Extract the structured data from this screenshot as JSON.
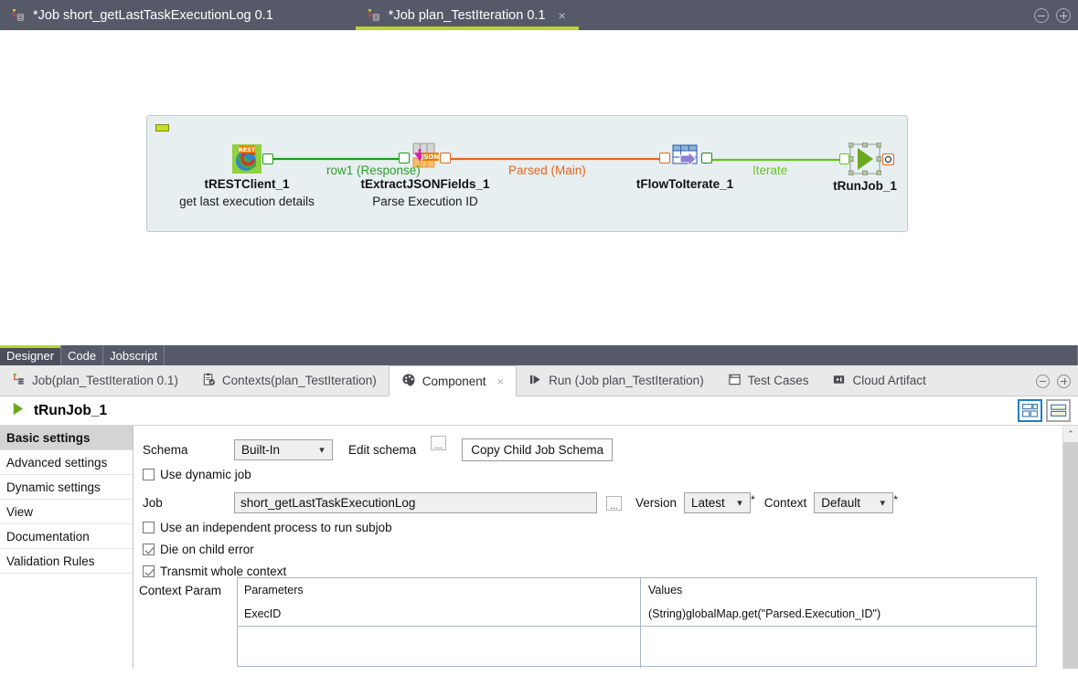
{
  "editor_tabs": [
    {
      "label": "*Job short_getLastTaskExecutionLog 0.1",
      "icon": "job-icon",
      "active": false,
      "closable": false
    },
    {
      "label": "*Job plan_TestIteration 0.1",
      "icon": "job-icon",
      "active": true,
      "closable": true,
      "close_label": "×"
    }
  ],
  "window_controls": {
    "minimize": "minimize-icon",
    "maximize": "maximize-icon"
  },
  "canvas": {
    "subjob_marker": "subjob-collapse-marker",
    "nodes": [
      {
        "name": "tRESTClient_1",
        "label": "tRESTClient_1",
        "sublabel": "get last execution details",
        "icon": "rest-client-icon"
      },
      {
        "name": "tExtractJSONFields_1",
        "label": "tExtractJSONFields_1",
        "sublabel": "Parse Execution ID",
        "icon": "extract-json-fields-icon"
      },
      {
        "name": "tFlowToIterate_1",
        "label": "tFlowToIterate_1",
        "sublabel": "",
        "icon": "flow-to-iterate-icon"
      },
      {
        "name": "tRunJob_1",
        "label": "tRunJob_1",
        "sublabel": "",
        "icon": "run-job-icon"
      }
    ],
    "links": [
      {
        "label": "row1 (Response)",
        "color": "#2aa02a"
      },
      {
        "label": "Parsed (Main)",
        "color": "#e8641c"
      },
      {
        "label": "Iterate",
        "color": "#66c41f"
      }
    ]
  },
  "designer_tabs": [
    {
      "label": "Designer",
      "active": true
    },
    {
      "label": "Code",
      "active": false
    },
    {
      "label": "Jobscript",
      "active": false
    }
  ],
  "view_tabs": [
    {
      "label": "Job(plan_TestIteration 0.1)",
      "icon": "job-icon",
      "active": false,
      "closable": false
    },
    {
      "label": "Contexts(plan_TestIteration)",
      "icon": "contexts-icon",
      "active": false,
      "closable": false
    },
    {
      "label": "Component",
      "icon": "component-palette-icon",
      "active": true,
      "closable": true,
      "close_label": "×"
    },
    {
      "label": "Run (Job plan_TestIteration)",
      "icon": "run-icon",
      "active": false,
      "closable": false
    },
    {
      "label": "Test Cases",
      "icon": "test-cases-icon",
      "active": false,
      "closable": false
    },
    {
      "label": "Cloud Artifact",
      "icon": "cloud-artifact-icon",
      "active": false,
      "closable": false
    }
  ],
  "component": {
    "title": "tRunJob_1",
    "icon": "run-job-icon",
    "view_toggle_grid": "grid-view-icon",
    "view_toggle_list": "list-view-icon"
  },
  "nav": {
    "items": [
      {
        "label": "Basic settings",
        "active": true
      },
      {
        "label": "Advanced settings",
        "active": false
      },
      {
        "label": "Dynamic settings",
        "active": false
      },
      {
        "label": "View",
        "active": false
      },
      {
        "label": "Documentation",
        "active": false
      },
      {
        "label": "Validation Rules",
        "active": false
      }
    ]
  },
  "basic_settings": {
    "schema_label": "Schema",
    "schema_value": "Built-In",
    "edit_schema_label": "Edit schema",
    "edit_schema_dots": "...",
    "copy_child_schema_label": "Copy Child Job Schema",
    "use_dynamic_job_label": "Use dynamic job",
    "use_dynamic_job_checked": false,
    "job_label": "Job",
    "job_value": "short_getLastTaskExecutionLog",
    "job_dots": "...",
    "version_label": "Version",
    "version_value": "Latest",
    "version_star": "*",
    "context_label": "Context",
    "context_value": "Default",
    "context_star": "*",
    "independent_process_label": "Use an independent process to run subjob",
    "independent_process_checked": false,
    "die_on_child_error_label": "Die on child error",
    "die_on_child_error_checked": true,
    "transmit_whole_context_label": "Transmit whole context",
    "transmit_whole_context_checked": true,
    "context_param_label": "Context Param",
    "context_param_headers": [
      "Parameters",
      "Values"
    ],
    "context_param_rows": [
      {
        "parameter": "ExecID",
        "value": "(String)globalMap.get(\"Parsed.Execution_ID\")"
      }
    ]
  },
  "scrollbar": {
    "up_arrow": "⌃"
  },
  "colors": {
    "accent_green": "#b9d430",
    "dark_chrome": "#565a68",
    "link_green": "#2aa02a",
    "link_orange": "#e8641c",
    "link_iterate": "#66c41f",
    "selection_blue": "#1e7ec8"
  }
}
